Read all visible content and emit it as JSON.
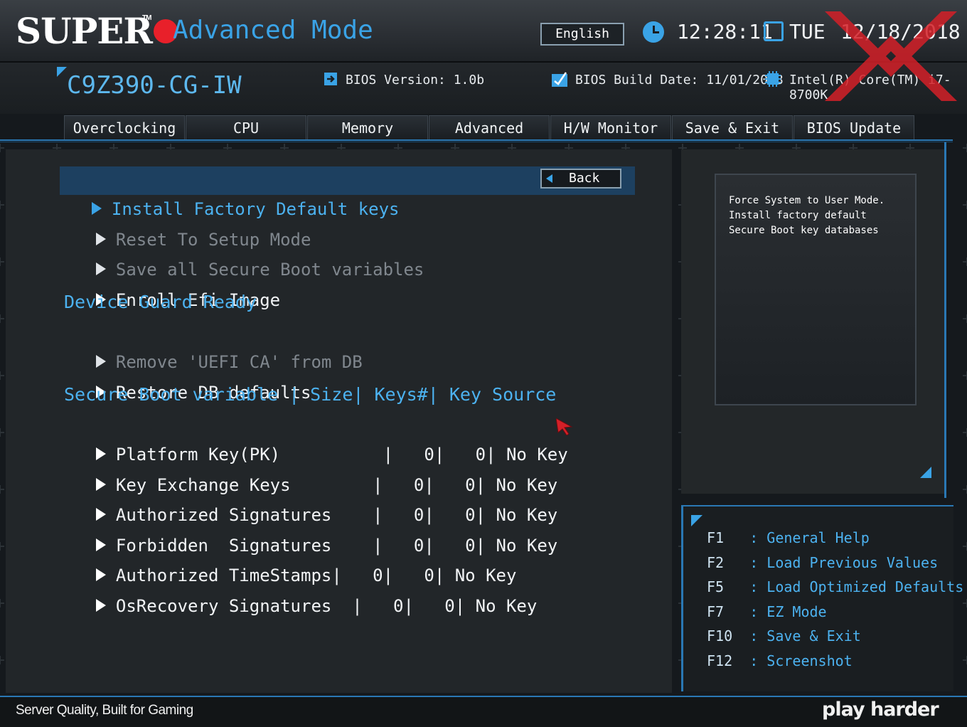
{
  "header": {
    "brand": "SUPER",
    "brand_tm": "TM",
    "mode_title": "Advanced Mode",
    "language": "English",
    "time": "12:28:11",
    "day": "TUE",
    "date": "12/18/2018"
  },
  "system": {
    "model": "C9Z390-CG-IW",
    "bios_version": "BIOS Version: 1.0b",
    "bios_build_date": "BIOS Build Date: 11/01/2018",
    "cpu": "Intel(R) Core(TM) i7-8700K"
  },
  "tabs": [
    {
      "label": "Overclocking"
    },
    {
      "label": "CPU"
    },
    {
      "label": "Memory"
    },
    {
      "label": "Advanced"
    },
    {
      "label": "H/W Monitor"
    },
    {
      "label": "Save & Exit"
    },
    {
      "label": "BIOS Update"
    }
  ],
  "menu": {
    "back_label": "Back",
    "items": [
      {
        "label": "Install Factory Default keys"
      },
      {
        "label": "Reset To Setup Mode"
      },
      {
        "label": "Save all Secure Boot variables"
      },
      {
        "label": "Enroll Efi Image"
      },
      {
        "label": "Device Guard Ready"
      },
      {
        "label": "Remove 'UEFI CA' from DB"
      },
      {
        "label": "Restore DB defaults"
      },
      {
        "label": "Secure Boot variable | Size| Keys#| Key Source"
      }
    ],
    "variables": [
      {
        "label": "Platform Key(PK)          |   0|   0| No Key"
      },
      {
        "label": "Key Exchange Keys        |   0|   0| No Key"
      },
      {
        "label": "Authorized Signatures    |   0|   0| No Key"
      },
      {
        "label": "Forbidden  Signatures    |   0|   0| No Key"
      },
      {
        "label": "Authorized TimeStamps|   0|   0| No Key"
      },
      {
        "label": "OsRecovery Signatures  |   0|   0| No Key"
      }
    ]
  },
  "help": {
    "text": "Force System to User Mode. Install factory default Secure Boot key databases"
  },
  "keys": [
    {
      "key": "F1 ",
      "desc": ": General Help"
    },
    {
      "key": "F2 ",
      "desc": ": Load Previous Values"
    },
    {
      "key": "F5 ",
      "desc": ": Load Optimized Defaults"
    },
    {
      "key": "F7 ",
      "desc": ": EZ Mode"
    },
    {
      "key": "F10",
      "desc": ": Save & Exit"
    },
    {
      "key": "F12",
      "desc": ": Screenshot"
    }
  ],
  "footer": {
    "slogan": "Server Quality, Built for Gaming",
    "tagline": "play harder"
  },
  "colors": {
    "accent": "#3aa3e6",
    "selected_bg": "#1d4060",
    "watermark": "#e8202a"
  }
}
